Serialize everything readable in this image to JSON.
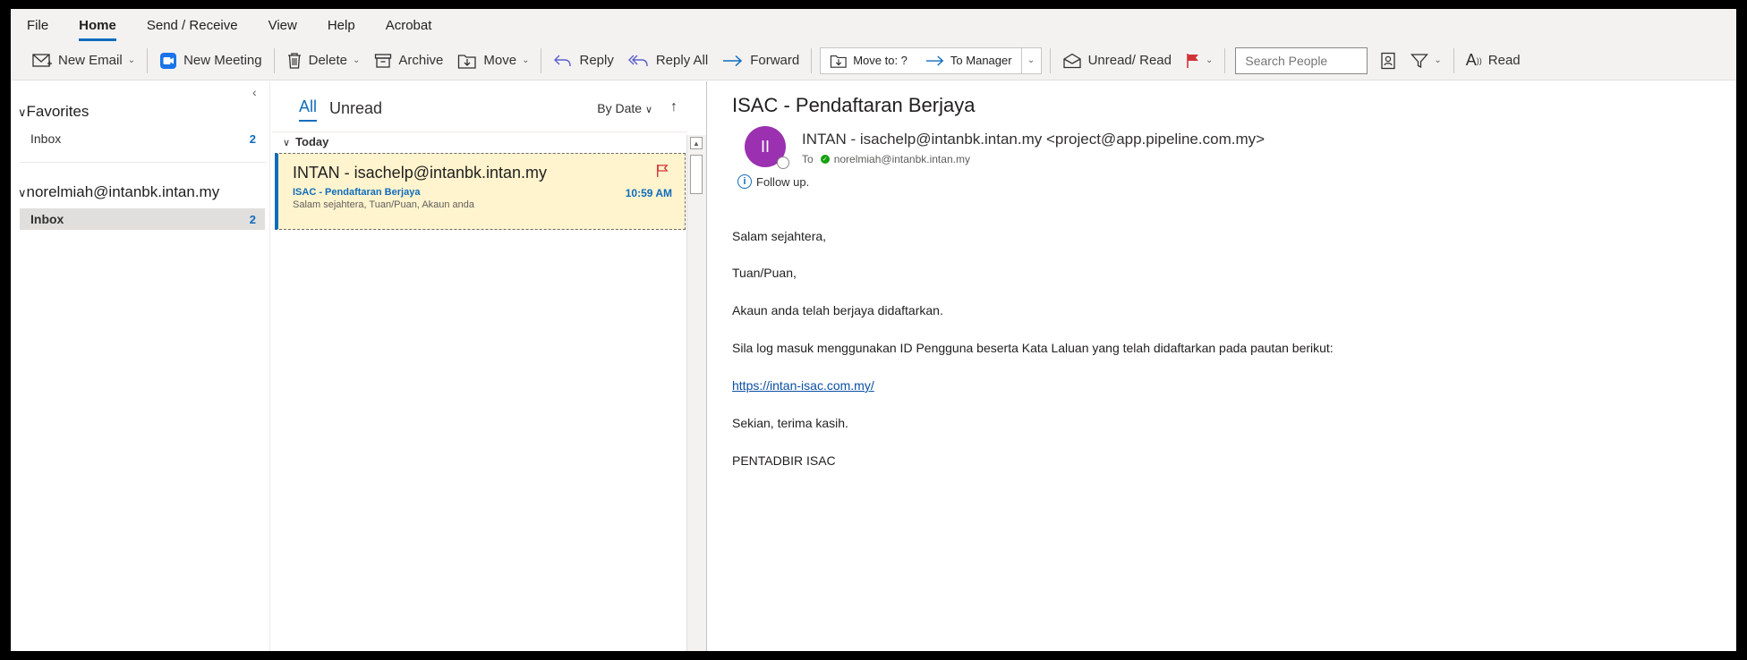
{
  "menubar": {
    "items": [
      "File",
      "Home",
      "Send / Receive",
      "View",
      "Help",
      "Acrobat"
    ],
    "active": "Home"
  },
  "ribbon": {
    "new_email": "New Email",
    "new_meeting": "New Meeting",
    "delete": "Delete",
    "archive": "Archive",
    "move": "Move",
    "reply": "Reply",
    "reply_all": "Reply All",
    "forward": "Forward",
    "quicksteps": {
      "move_to": "Move to: ?",
      "to_manager": "To Manager"
    },
    "unread_read": "Unread/ Read",
    "search_people_placeholder": "Search People",
    "read_aloud": "Read"
  },
  "folders": {
    "favorites_label": "Favorites",
    "favorites_inbox": {
      "label": "Inbox",
      "count": "2"
    },
    "account_label": "norelmiah@intanbk.intan.my",
    "account_inbox": {
      "label": "Inbox",
      "count": "2"
    }
  },
  "list": {
    "tab_all": "All",
    "tab_unread": "Unread",
    "sort_label": "By Date",
    "group_label": "Today",
    "message": {
      "from": "INTAN - isachelp@intanbk.intan.my",
      "subject": "ISAC - Pendaftaran Berjaya",
      "preview": "Salam sejahtera,  Tuan/Puan,  Akaun anda",
      "time": "10:59 AM"
    }
  },
  "reading": {
    "subject": "ISAC - Pendaftaran Berjaya",
    "avatar_initials": "II",
    "from": "INTAN - isachelp@intanbk.intan.my <project@app.pipeline.com.my>",
    "to_label": "To",
    "to_address": "norelmiah@intanbk.intan.my",
    "followup": "Follow up.",
    "body": [
      "Salam sejahtera,",
      "Tuan/Puan,",
      "Akaun anda telah berjaya didaftarkan.",
      "Sila log masuk menggunakan ID Pengguna beserta Kata Laluan yang telah didaftarkan pada pautan berikut:",
      "https://intan-isac.com.my/",
      "Sekian, terima kasih.",
      "PENTADBIR ISAC"
    ]
  },
  "colors": {
    "accent": "#0f6cbd",
    "flag": "#d13438",
    "selected_item_bg": "#fff4ce",
    "avatar": "#9b30b0"
  }
}
